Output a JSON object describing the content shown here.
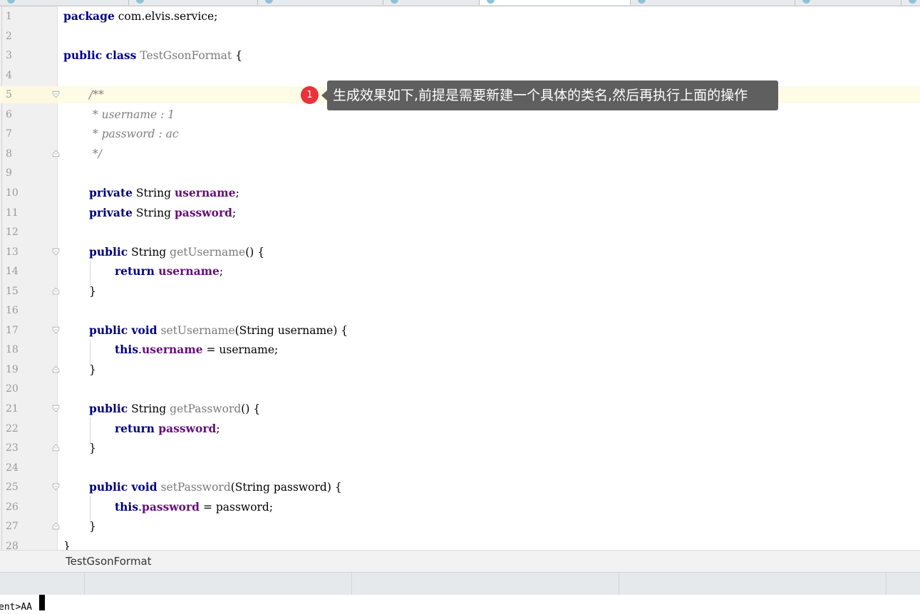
{
  "tooltip": {
    "badge": "1",
    "text": "生成效果如下,前提是需要新建一个具体的类名,然后再执行上面的操作"
  },
  "breadcrumb": {
    "label": "TestGsonFormat"
  },
  "terminal": {
    "prompt": "ent>AA"
  },
  "colors": {
    "keyword": "#000080",
    "field": "#660e7a",
    "comment": "#808080",
    "current_line": "#fefbe6",
    "badge": "#e8333a",
    "tooltip_bg": "#5f5f5f"
  },
  "code": {
    "line_numbers": [
      "1",
      "2",
      "3",
      "4",
      "5",
      "6",
      "7",
      "8",
      "9",
      "10",
      "11",
      "12",
      "13",
      "14",
      "15",
      "16",
      "17",
      "18",
      "19",
      "20",
      "21",
      "22",
      "23",
      "24",
      "25",
      "26",
      "27",
      "28"
    ],
    "l1": {
      "kw": "package",
      "rest": " com.elvis.service;"
    },
    "l3": {
      "kw": "public class",
      "name": " TestGsonFormat",
      "rest": " {"
    },
    "l5": {
      "text": "/**"
    },
    "l6": {
      "text": " * username : 1"
    },
    "l7": {
      "text": " * password : ac"
    },
    "l8": {
      "text": " */"
    },
    "l10": {
      "kw": "private",
      "type": " String ",
      "field": "username",
      "rest": ";"
    },
    "l11": {
      "kw": "private",
      "type": " String ",
      "field": "password",
      "rest": ";"
    },
    "l13": {
      "kw": "public",
      "type": " String ",
      "method": "getUsername",
      "rest": "() {"
    },
    "l14": {
      "kw": "return",
      "field": " username",
      "rest": ";"
    },
    "l15": {
      "text": "}"
    },
    "l17": {
      "kw": "public void",
      "method": " setUsername",
      "rest": "(String username) {"
    },
    "l18": {
      "kw": "this",
      "dot": ".",
      "field": "username",
      "rest": " = username;"
    },
    "l19": {
      "text": "}"
    },
    "l21": {
      "kw": "public",
      "type": " String ",
      "method": "getPassword",
      "rest": "() {"
    },
    "l22": {
      "kw": "return",
      "field": " password",
      "rest": ";"
    },
    "l23": {
      "text": "}"
    },
    "l25": {
      "kw": "public void",
      "method": " setPassword",
      "rest": "(String password) {"
    },
    "l26": {
      "kw": "this",
      "dot": ".",
      "field": "password",
      "rest": " = password;"
    },
    "l27": {
      "text": "}"
    },
    "l28": {
      "text": "}"
    }
  }
}
